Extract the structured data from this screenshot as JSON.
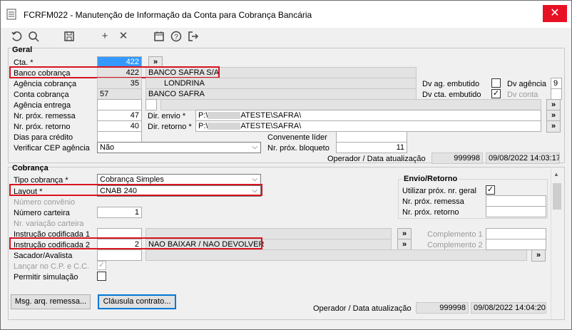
{
  "window": {
    "title": "FCRFM022 - Manutenção de Informação da Conta para Cobrança Bancária"
  },
  "toolbar": {
    "icons": [
      "undo-icon",
      "search-icon",
      "save-icon",
      "add-icon",
      "delete-icon",
      "calendar-icon",
      "help-icon",
      "exit-icon"
    ]
  },
  "geral": {
    "section_label": "Geral",
    "cta_label": "Cta. *",
    "cta_value": "422",
    "banco_label": "Banco cobrança",
    "banco_code": "422",
    "banco_name": "BANCO SAFRA S/A",
    "agencia_label": "Agência cobrança",
    "agencia_code": "35",
    "agencia_name": "LONDRINA",
    "conta_label": "Conta cobrança",
    "conta_value": "57",
    "conta_name": "BANCO SAFRA",
    "agencia_entrega_label": "Agência entrega",
    "prox_remessa_label": "Nr. próx. remessa",
    "prox_remessa_value": "47",
    "prox_retorno_label": "Nr. próx. retorno",
    "prox_retorno_value": "40",
    "dias_credito_label": "Dias para crédito",
    "cep_label": "Verificar CEP agência",
    "cep_value": "Não",
    "dv_ag_embutido_label": "Dv ag. embutido",
    "dv_agencia_label": "Dv agência",
    "dv_agencia_value": "9",
    "dv_cta_embutido_label": "Dv cta. embutido",
    "dv_conta_label": "Dv conta",
    "dir_envio_label": "Dir. envio *",
    "dir_envio_value": "P:\\",
    "dir_envio_suffix": "ATESTE\\SAFRA\\",
    "dir_retorno_label": "Dir. retorno *",
    "dir_retorno_value": "P:\\",
    "dir_retorno_suffix": "ATESTE\\SAFRA\\",
    "convenente_label": "Convenente líder",
    "bloqueto_label": "Nr. próx. bloqueto",
    "bloqueto_value": "11",
    "operador_label": "Operador / Data atualização",
    "operador_value": "999998",
    "data_value": "09/08/2022 14:03:17"
  },
  "cobranca": {
    "section_label": "Cobrança",
    "tipo_label": "Tipo cobrança *",
    "tipo_value": "Cobrança Simples",
    "layout_label": "Layout *",
    "layout_value": "CNAB 240",
    "numero_convenio_label": "Número convênio",
    "numero_carteira_label": "Número carteira",
    "numero_carteira_value": "1",
    "variacao_label": "Nr. variação carteira",
    "instr1_label": "Instrução codificada 1",
    "instr2_label": "Instrução codificada 2",
    "instr2_code": "2",
    "instr2_name": "NAO BAIXAR / NAO DEVOLVER",
    "sacador_label": "Sacador/Avalista",
    "lancar_label": "Lançar no C.P. e C.C.",
    "simulacao_label": "Permitir simulação",
    "complemento1_label": "Complemento 1",
    "complemento2_label": "Complemento 2",
    "envio_retorno_label": "Envio/Retorno",
    "utilizar_label": "Utilizar próx. nr. geral",
    "nr_remessa_label": "Nr. próx. remessa",
    "nr_retorno_label": "Nr. próx. retorno",
    "msg_button": "Msg. arq. remessa...",
    "clausula_button": "Cláusula contrato...",
    "operador_label": "Operador / Data atualização",
    "operador_value": "999998",
    "data_value": "09/08/2022 14:04:20"
  },
  "arrow_button": "»",
  "check_mark": "✓",
  "dropdown_arrow": "⌵"
}
